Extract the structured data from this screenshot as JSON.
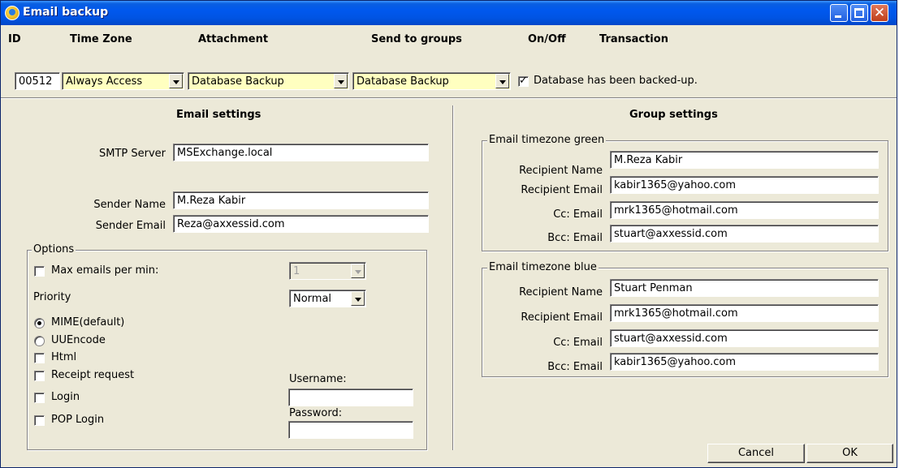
{
  "window": {
    "title": "Email backup"
  },
  "columns": {
    "id": "ID",
    "time_zone": "Time Zone",
    "attachment": "Attachment",
    "send_to_groups": "Send to groups",
    "on_off": "On/Off",
    "transaction": "Transaction"
  },
  "record": {
    "id": "00512",
    "time_zone": "Always Access",
    "attachment": "Database Backup",
    "send_to_groups": "Database Backup",
    "on_off_checked": true,
    "transaction": "Database has been backed-up."
  },
  "email_settings": {
    "title": "Email settings",
    "smtp_label": "SMTP Server",
    "smtp_value": "MSExchange.local",
    "sender_name_label": "Sender Name",
    "sender_name_value": "M.Reza Kabir",
    "sender_email_label": "Sender Email",
    "sender_email_value": "Reza@axxessid.com",
    "options": {
      "legend": "Options",
      "max_emails_label": "Max emails per min:",
      "max_emails_checked": false,
      "max_emails_value": "1",
      "priority_label": "Priority",
      "priority_value": "Normal",
      "mime_label": "MIME(default)",
      "mime_selected": true,
      "uuencode_label": "UUEncode",
      "html_label": "Html",
      "receipt_label": "Receipt request",
      "login_label": "Login",
      "pop_login_label": "POP Login",
      "username_label": "Username:",
      "username_value": "",
      "password_label": "Password:",
      "password_value": ""
    }
  },
  "group_settings": {
    "title": "Group settings",
    "groups": [
      {
        "legend": "Email timezone green",
        "recipient_name_label": "Recipient Name",
        "recipient_name": "M.Reza Kabir",
        "recipient_email_label": "Recipient Email",
        "recipient_email": "kabir1365@yahoo.com",
        "cc_label": "Cc: Email",
        "cc": "mrk1365@hotmail.com",
        "bcc_label": "Bcc: Email",
        "bcc": "stuart@axxessid.com"
      },
      {
        "legend": "Email timezone blue",
        "recipient_name_label": "Recipient Name",
        "recipient_name": "Stuart Penman",
        "recipient_email_label": "Recipient Email",
        "recipient_email": "mrk1365@hotmail.com",
        "cc_label": "Cc: Email",
        "cc": "stuart@axxessid.com",
        "bcc_label": "Bcc: Email",
        "bcc": "kabir1365@yahoo.com"
      }
    ]
  },
  "buttons": {
    "cancel": "Cancel",
    "ok": "OK"
  },
  "icons": {
    "app": "app-globe-icon",
    "minimize": "minimize-icon",
    "maximize": "maximize-icon",
    "close": "close-icon",
    "dropdown": "chevron-down-icon"
  },
  "colors": {
    "title_bar": "#0054e3",
    "window_bg": "#ece9d8",
    "combo_highlight": "#ffffc0",
    "close_button": "#d65c3a"
  }
}
